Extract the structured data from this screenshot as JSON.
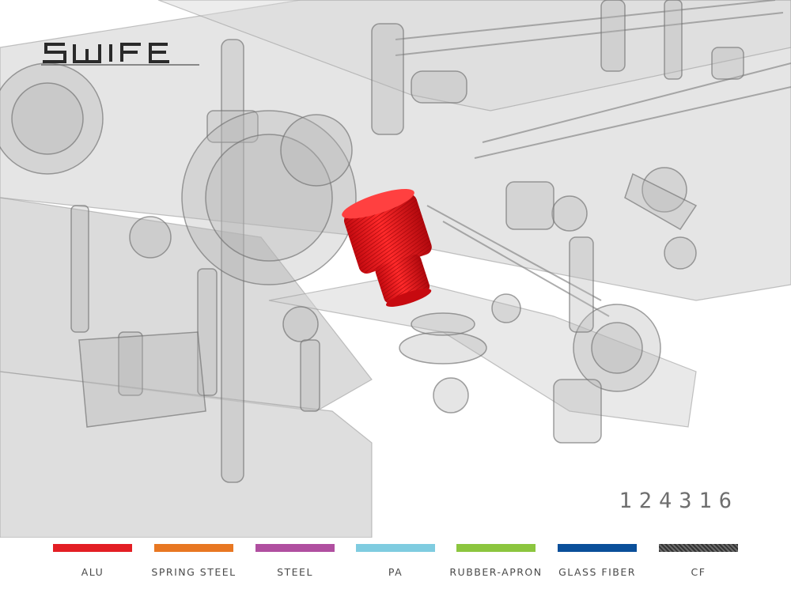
{
  "brand": {
    "logo_text": "SWIFE"
  },
  "part_number": "124316",
  "highlight_color": "#e8141a",
  "materials": [
    {
      "label": "ALU",
      "color": "#e31e24"
    },
    {
      "label": "SPRING STEEL",
      "color": "#e87722"
    },
    {
      "label": "STEEL",
      "color": "#b04fa0"
    },
    {
      "label": "PA",
      "color": "#7fcce0"
    },
    {
      "label": "RUBBER-APRON",
      "color": "#8cc63f"
    },
    {
      "label": "GLASS FIBER",
      "color": "#0a4f9a"
    },
    {
      "label": "CF",
      "color": "#444444"
    }
  ]
}
